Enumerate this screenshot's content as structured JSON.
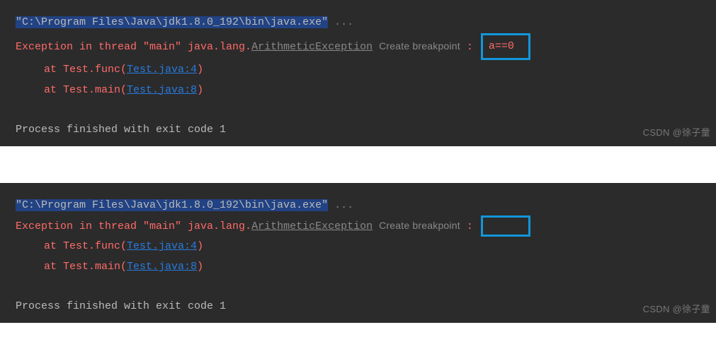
{
  "panel1": {
    "cmd_prefix": "\"C:\\Program Files\\Java\\jdk1.8.0_192\\bin\\java.exe\"",
    "cmd_suffix": " ...",
    "exc_prefix": "Exception in thread \"main\" java.lang.",
    "exc_class": "ArithmeticException",
    "breakpoint": "Create breakpoint",
    "colon": " : ",
    "message": "a==0",
    "stack": [
      {
        "prefix": "at Test.func(",
        "link": "Test.java:4",
        "suffix": ")"
      },
      {
        "prefix": "at Test.main(",
        "link": "Test.java:8",
        "suffix": ")"
      }
    ],
    "exit": "Process finished with exit code 1",
    "watermark": "CSDN @徐子童"
  },
  "panel2": {
    "cmd_prefix": "\"C:\\Program Files\\Java\\jdk1.8.0_192\\bin\\java.exe\"",
    "cmd_suffix": " ...",
    "exc_prefix": "Exception in thread \"main\" java.lang.",
    "exc_class": "ArithmeticException",
    "breakpoint": "Create breakpoint",
    "colon": " : ",
    "message": "",
    "stack": [
      {
        "prefix": "at Test.func(",
        "link": "Test.java:4",
        "suffix": ")"
      },
      {
        "prefix": "at Test.main(",
        "link": "Test.java:8",
        "suffix": ")"
      }
    ],
    "exit": "Process finished with exit code 1",
    "watermark": "CSDN @徐子童"
  }
}
